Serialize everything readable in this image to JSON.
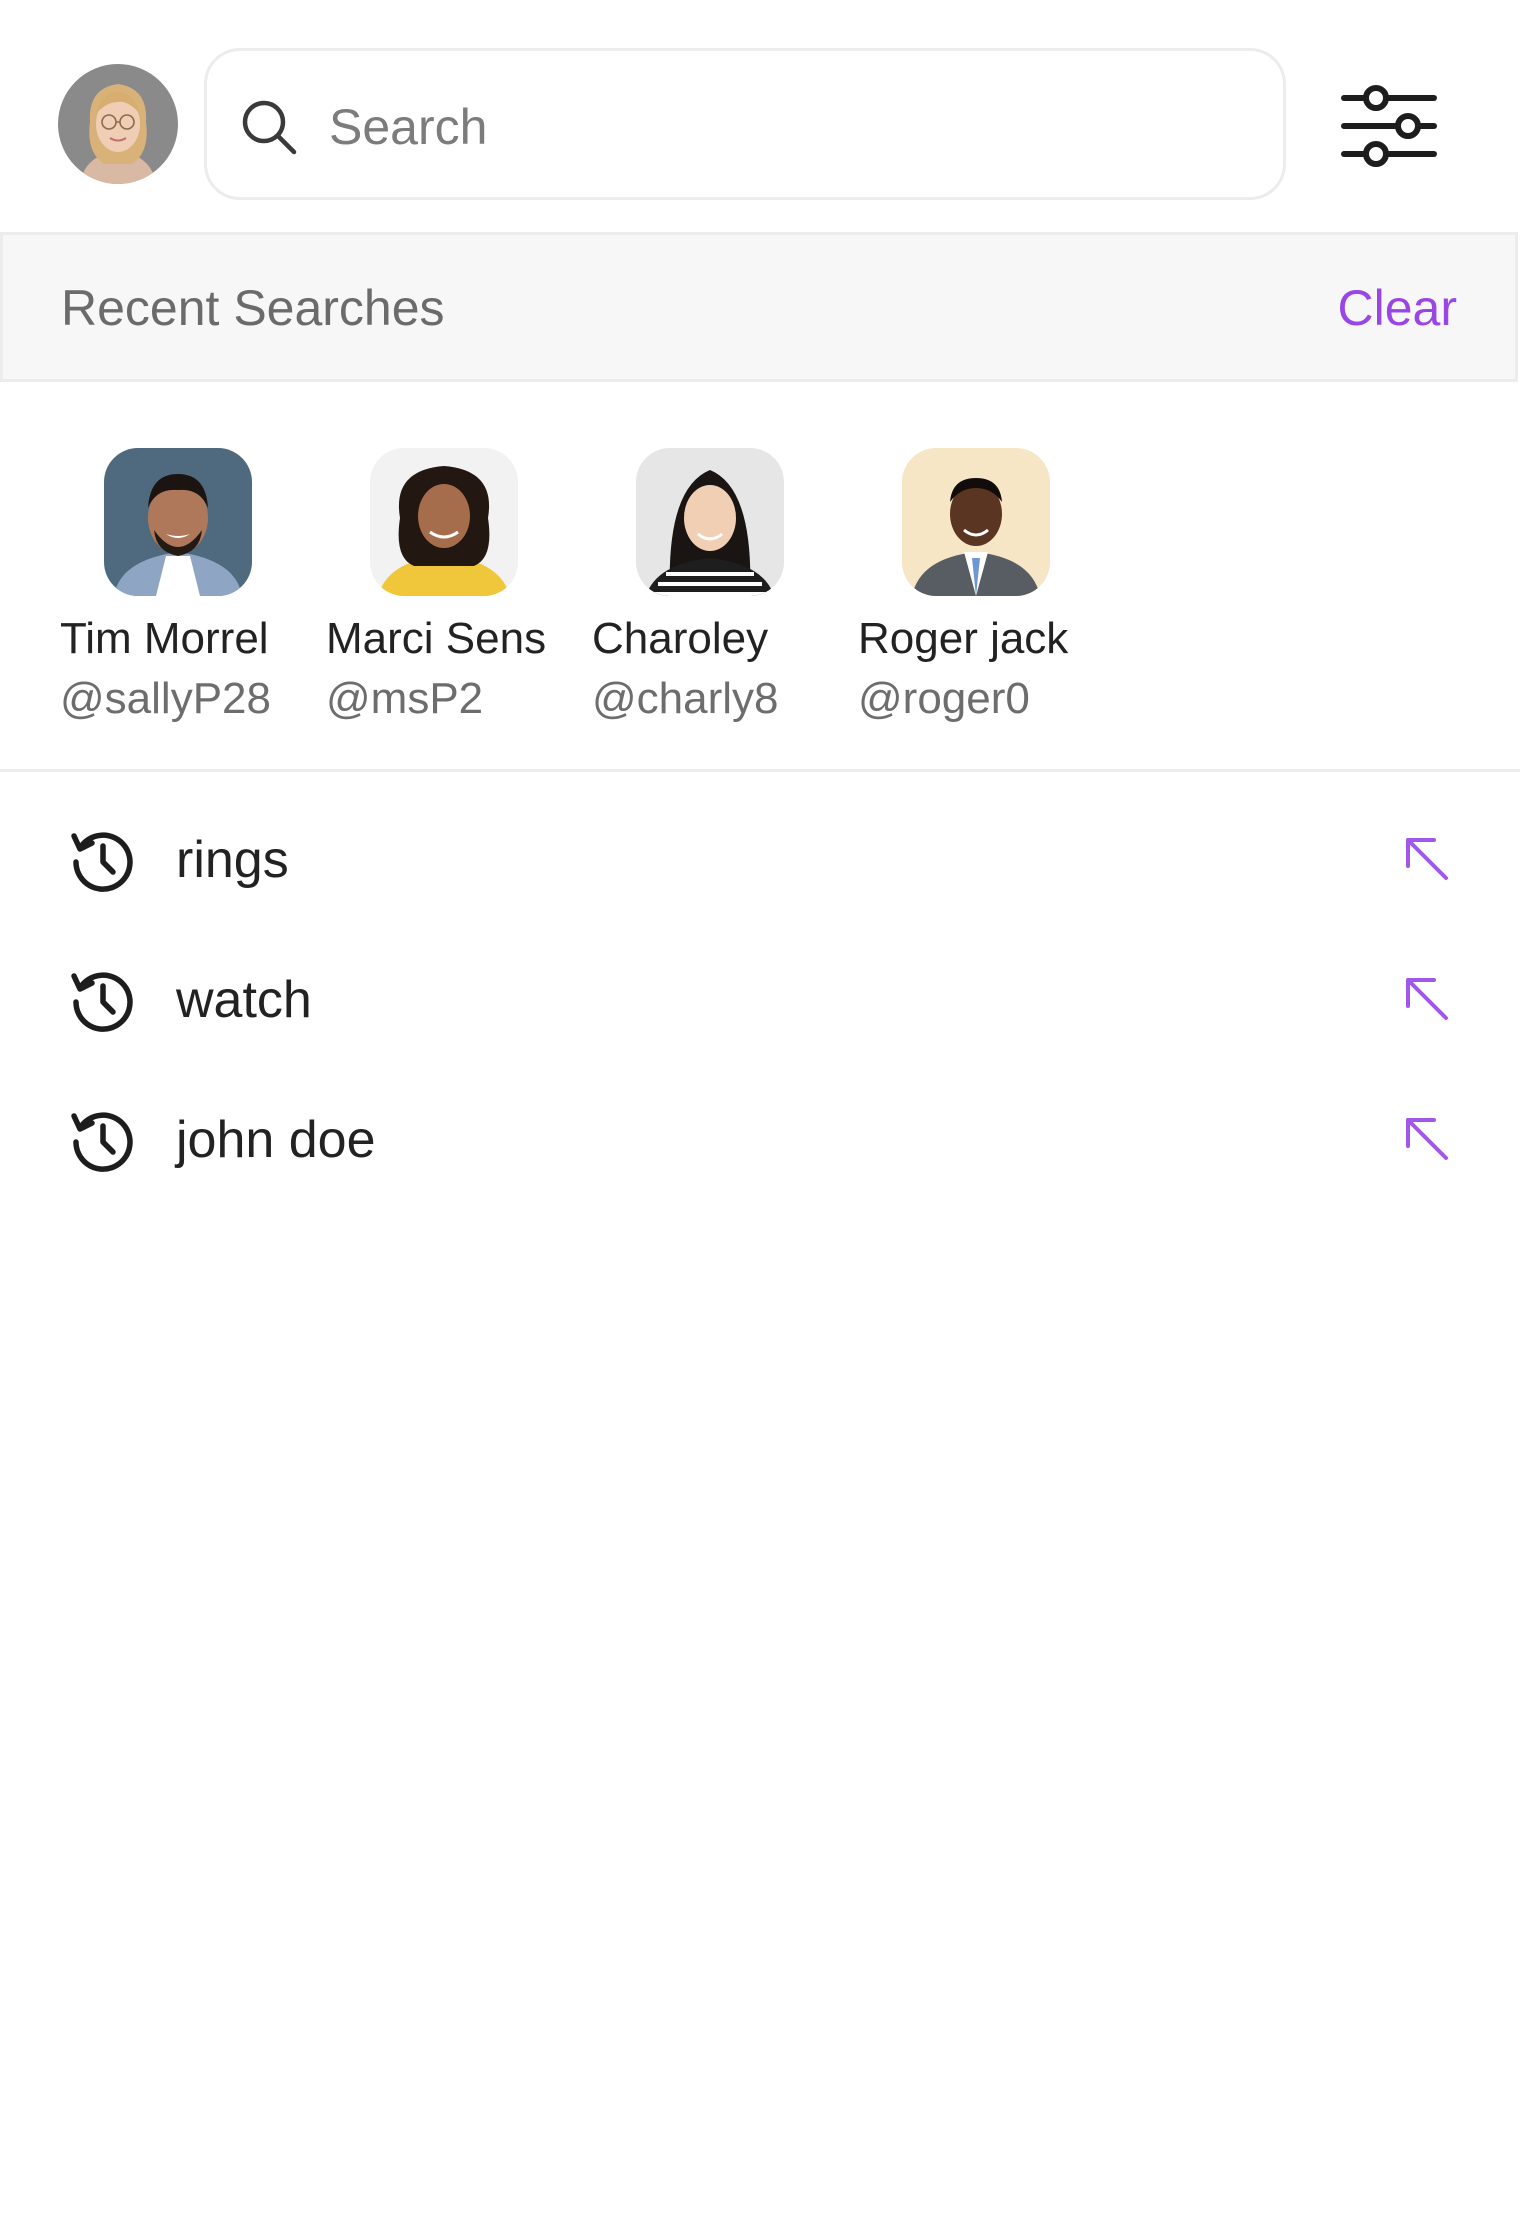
{
  "search": {
    "placeholder": "Search",
    "value": ""
  },
  "header": {
    "user_avatar_icon": "user-avatar",
    "search_icon": "search-icon",
    "filter_icon": "sliders-icon"
  },
  "recent": {
    "title": "Recent Searches",
    "clear_label": "Clear",
    "accent_color": "#9a46e6"
  },
  "people": [
    {
      "name": "Tim Morrel",
      "handle": "@sallyP28"
    },
    {
      "name": "Marci Sens",
      "handle": "@msP2"
    },
    {
      "name": "Charoley",
      "handle": "@charly8"
    },
    {
      "name": "Roger jack",
      "handle": "@roger0"
    }
  ],
  "history": [
    {
      "term": "rings",
      "icon": "history-icon",
      "action_icon": "arrow-up-left-icon"
    },
    {
      "term": "watch",
      "icon": "history-icon",
      "action_icon": "arrow-up-left-icon"
    },
    {
      "term": "john doe",
      "icon": "history-icon",
      "action_icon": "arrow-up-left-icon"
    }
  ]
}
